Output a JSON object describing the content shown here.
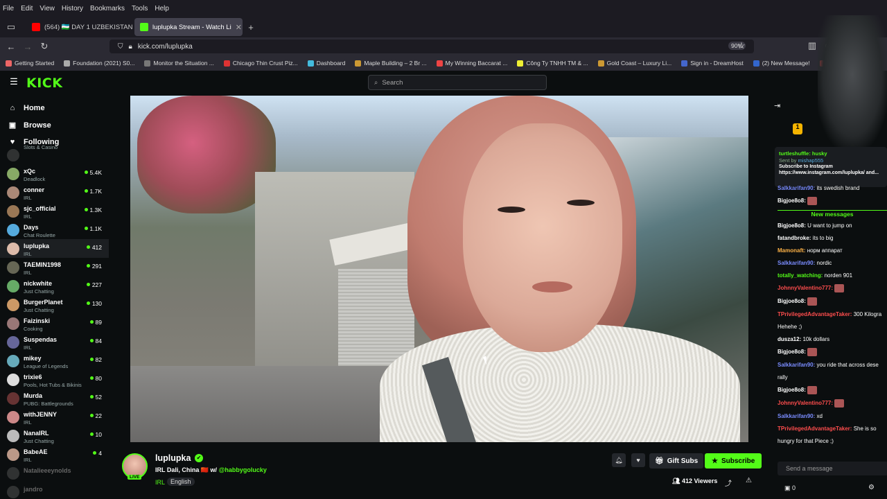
{
  "browser": {
    "menu": [
      "File",
      "Edit",
      "View",
      "History",
      "Bookmarks",
      "Tools",
      "Help"
    ],
    "tabs": [
      {
        "title": "(564) 🇺🇿 DAY 1 UZBEKISTAN",
        "color": "#ff0000"
      },
      {
        "title": "luplupka Stream - Watch Li",
        "color": "#53fc18"
      }
    ],
    "url": "kick.com/luplupka",
    "zoom": "90%",
    "bookmarks": [
      {
        "label": "Getting Started",
        "color": "#e66"
      },
      {
        "label": "Foundation (2021) S0...",
        "color": "#aaa"
      },
      {
        "label": "Monitor the Situation ...",
        "color": "#777"
      },
      {
        "label": "Chicago Thin Crust Piz...",
        "color": "#d33"
      },
      {
        "label": "Dashboard",
        "color": "#4bd"
      },
      {
        "label": "Maple Building – 2 Br ...",
        "color": "#c93"
      },
      {
        "label": "My Winning Baccarat ...",
        "color": "#e44"
      },
      {
        "label": "Công Ty TNHH TM & ...",
        "color": "#ee3"
      },
      {
        "label": "Gold Coast – Luxury Li...",
        "color": "#c93"
      },
      {
        "label": "Sign in - DreamHost",
        "color": "#46c"
      },
      {
        "label": "(2) New Message!",
        "color": "#36c"
      },
      {
        "label": "Voice (Korean Dran",
        "color": "#c44"
      }
    ]
  },
  "kick": {
    "logo": "KICK",
    "search_placeholder": "Search",
    "nav": [
      {
        "label": "Home",
        "icon": "home-icon",
        "glyph": "⌂"
      },
      {
        "label": "Browse",
        "icon": "browse-icon",
        "glyph": "▣"
      },
      {
        "label": "Following",
        "icon": "heart-icon",
        "glyph": "♥"
      }
    ],
    "following": [
      {
        "name": "",
        "cat": "Slots & Casino",
        "viewers": "",
        "color": "#555"
      },
      {
        "name": "xQc",
        "cat": "Deadlock",
        "viewers": "5.4K",
        "color": "#8a6"
      },
      {
        "name": "conner",
        "cat": "IRL",
        "viewers": "1.7K",
        "color": "#a87"
      },
      {
        "name": "sjc_official",
        "cat": "IRL",
        "viewers": "1.3K",
        "color": "#975"
      },
      {
        "name": "Days",
        "cat": "Chat Roulette",
        "viewers": "1.1K",
        "color": "#5ad"
      },
      {
        "name": "luplupka",
        "cat": "IRL",
        "viewers": "412",
        "color": "#dba"
      },
      {
        "name": "TAEMIN1998",
        "cat": "IRL",
        "viewers": "291",
        "color": "#665"
      },
      {
        "name": "nickwhite",
        "cat": "Just Chatting",
        "viewers": "227",
        "color": "#6a6"
      },
      {
        "name": "BurgerPlanet",
        "cat": "Just Chatting",
        "viewers": "130",
        "color": "#c96"
      },
      {
        "name": "Faizinski",
        "cat": "Cooking",
        "viewers": "89",
        "color": "#977"
      },
      {
        "name": "Suspendas",
        "cat": "IRL",
        "viewers": "84",
        "color": "#669"
      },
      {
        "name": "mikey",
        "cat": "League of Legends",
        "viewers": "82",
        "color": "#6ab"
      },
      {
        "name": "trixie6",
        "cat": "Pools, Hot Tubs & Bikinis",
        "viewers": "80",
        "color": "#ddd"
      },
      {
        "name": "Murda",
        "cat": "PUBG: Battlegrounds",
        "viewers": "52",
        "color": "#633"
      },
      {
        "name": "withJENNY",
        "cat": "IRL",
        "viewers": "22",
        "color": "#c88"
      },
      {
        "name": "NanaIRL",
        "cat": "Just Chatting",
        "viewers": "10",
        "color": "#bbb"
      },
      {
        "name": "BabeAE",
        "cat": "IRL",
        "viewers": "4",
        "color": "#b98"
      },
      {
        "name": "Natalieeeynolds",
        "cat": "",
        "viewers": "",
        "color": "#555"
      },
      {
        "name": "jandro",
        "cat": "",
        "viewers": "",
        "color": "#555"
      }
    ],
    "stream": {
      "name": "luplupka",
      "live": "LIVE",
      "title": "IRL Dali, China 🇨🇳 w/",
      "mention": "@habbygolucky",
      "category": "IRL",
      "language": "English",
      "viewers": "412 Viewers",
      "gift_label": "Gift Subs",
      "subscribe_label": "Subscribe"
    },
    "chat": {
      "pinned_user": "turtleshuffle: husky",
      "pinned_sender": "Sent by",
      "pinned_sender_name": "mishap555",
      "pinned_text": "Subscribe to Instagram https://www.instagram.com/luplupka/ and...",
      "messages": [
        {
          "user": "Salkkarifan90:",
          "text": "its swedish brand",
          "color": "#7a8cff"
        },
        {
          "user": "Bigjoe8o8:",
          "text": "",
          "color": "#fff",
          "emote": true
        },
        {
          "divider": "New messages"
        },
        {
          "user": "Bigjoe8o8:",
          "text": "U want to jump on",
          "color": "#fff"
        },
        {
          "user": "fatandbroke:",
          "text": "its to big",
          "color": "#fff"
        },
        {
          "user": "Mamonaft:",
          "text": "норм аппарат",
          "color": "#ffb347"
        },
        {
          "user": "Salkkarifan90:",
          "text": "nordic",
          "color": "#7a8cff"
        },
        {
          "user": "totally_watching:",
          "text": "norden 901",
          "color": "#53fc18"
        },
        {
          "user": "JohnnyValentino777:",
          "text": "",
          "color": "#ff4d4d",
          "emote": true
        },
        {
          "user": "Bigjoe8o8:",
          "text": "",
          "color": "#fff",
          "emote": true
        },
        {
          "user": "TPrivilegedAdvantageTaker:",
          "text": "300 Kilogra",
          "color": "#ff4d4d"
        },
        {
          "user": "",
          "text": "Hehehe ;)",
          "color": "#fff"
        },
        {
          "user": "dusza12:",
          "text": "10k dollars",
          "color": "#fff"
        },
        {
          "user": "Bigjoe8o8:",
          "text": "",
          "color": "#fff",
          "emote": true
        },
        {
          "user": "Salkkarifan90:",
          "text": "you ride that across dese",
          "color": "#7a8cff"
        },
        {
          "user": "",
          "text": "rally",
          "color": "#fff"
        },
        {
          "user": "Bigjoe8o8:",
          "text": "",
          "color": "#fff",
          "emote": true
        },
        {
          "user": "JohnnyValentino777:",
          "text": "",
          "color": "#ff4d4d",
          "emote": true
        },
        {
          "user": "Salkkarifan90:",
          "text": "xd",
          "color": "#7a8cff"
        },
        {
          "user": "TPrivilegedAdvantageTaker:",
          "text": "She is so",
          "color": "#ff4d4d"
        },
        {
          "user": "",
          "text": "hungry for that Piece ;)",
          "color": "#fff"
        }
      ],
      "input_placeholder": "Send a message",
      "points": "0"
    }
  }
}
